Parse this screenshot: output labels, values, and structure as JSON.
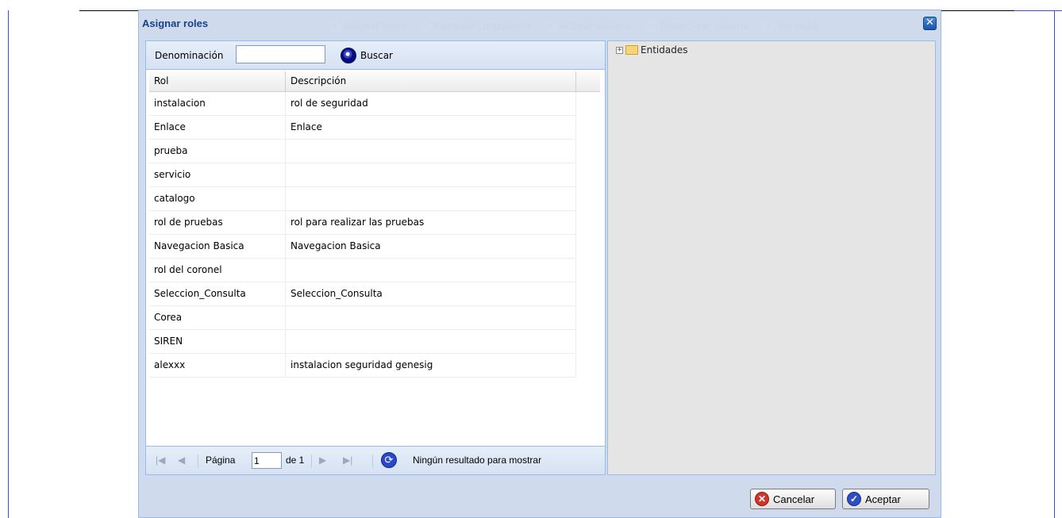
{
  "background_toolbar": {
    "items": [
      "Asignar roles",
      "Cambiar contraseña",
      "Activar usuario",
      "Desactivar usuario",
      "Ver ficha"
    ]
  },
  "window": {
    "title": "Asignar roles",
    "close_icon": "close-icon"
  },
  "filter": {
    "label": "Denominación",
    "value": "",
    "search_label": "Buscar"
  },
  "grid": {
    "columns": [
      "Rol",
      "Descripción"
    ],
    "rows": [
      {
        "rol": "instalacion",
        "descripcion": "rol de seguridad"
      },
      {
        "rol": "Enlace",
        "descripcion": "Enlace"
      },
      {
        "rol": "prueba",
        "descripcion": ""
      },
      {
        "rol": "servicio",
        "descripcion": ""
      },
      {
        "rol": "catalogo",
        "descripcion": ""
      },
      {
        "rol": "rol de pruebas",
        "descripcion": "rol para realizar las pruebas"
      },
      {
        "rol": "Navegacion Basica",
        "descripcion": "Navegacion Basica"
      },
      {
        "rol": "rol del coronel",
        "descripcion": ""
      },
      {
        "rol": "Seleccion_Consulta",
        "descripcion": "Seleccion_Consulta"
      },
      {
        "rol": "Corea",
        "descripcion": ""
      },
      {
        "rol": "SIREN",
        "descripcion": ""
      },
      {
        "rol": "alexxx",
        "descripcion": "instalacion seguridad genesig"
      }
    ]
  },
  "pager": {
    "page_label": "Página",
    "page_value": "1",
    "of_label": "de 1",
    "status": "Ningún resultado para mostrar"
  },
  "tree": {
    "root_label": "Entidades",
    "expander": "+"
  },
  "buttons": {
    "cancel": "Cancelar",
    "accept": "Aceptar"
  },
  "colors": {
    "window_bg": "#cfdbec",
    "title": "#15428b",
    "border": "#99bbe8"
  }
}
